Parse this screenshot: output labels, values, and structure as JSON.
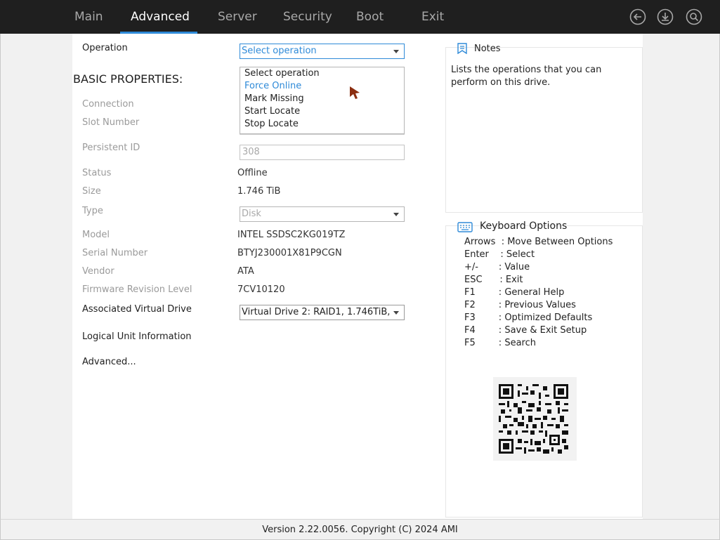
{
  "tabs": [
    {
      "label": "Main",
      "active": false
    },
    {
      "label": "Advanced",
      "active": true
    },
    {
      "label": "Server",
      "active": false
    },
    {
      "label": "Security",
      "active": false
    },
    {
      "label": "Boot",
      "active": false
    },
    {
      "label": "Exit",
      "active": false
    }
  ],
  "toolbar_icons": [
    "back-icon",
    "download-icon",
    "search-icon"
  ],
  "form": {
    "operation_label": "Operation",
    "operation_value": "Select operation",
    "heading": "BASIC PROPERTIES:",
    "connection_label": "Connection",
    "slot_label": "Slot Number",
    "persistent_label": "Persistent ID",
    "persistent_value": "308",
    "status_label": "Status",
    "status_value": "Offline",
    "size_label": "Size",
    "size_value": "1.746 TiB",
    "type_label": "Type",
    "type_value": "Disk",
    "model_label": "Model",
    "model_value": "INTEL SSDSC2KG019TZ",
    "serial_label": "Serial Number",
    "serial_value": "BTYJ230001X81P9CGN",
    "vendor_label": "Vendor",
    "vendor_value": "ATA",
    "firmware_label": "Firmware Revision Level",
    "firmware_value": "7CV10120",
    "assoc_label": "Associated Virtual Drive",
    "assoc_value": "Virtual Drive 2: RAID1, 1.746TiB,",
    "logical_label": "Logical Unit Information",
    "advanced_label": "Advanced..."
  },
  "dropdown": {
    "options": [
      "Select operation",
      "Force Online",
      "Mark Missing",
      "Start Locate",
      "Stop Locate"
    ],
    "highlighted": "Force Online"
  },
  "notes": {
    "title": "Notes",
    "text": "Lists the operations that you can perform on this drive."
  },
  "keyboard": {
    "title": "Keyboard Options",
    "lines": [
      "Arrows  : Move Between Options",
      "Enter    : Select",
      "+/-       : Value",
      "ESC      : Exit",
      "F1        : General Help",
      "F2        : Previous Values",
      "F3        : Optimized Defaults",
      "F4        : Save & Exit Setup",
      "F5        : Search"
    ]
  },
  "footer": "Version 2.22.0056. Copyright (C) 2024 AMI",
  "colors": {
    "accent": "#2e8ad8",
    "topbar": "#1f1f1f",
    "cursor": "#8b2e10"
  }
}
